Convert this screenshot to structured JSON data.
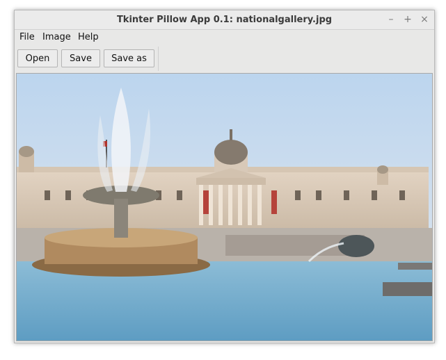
{
  "window": {
    "title": "Tkinter Pillow App 0.1: nationalgallery.jpg",
    "controls": {
      "minimize": "–",
      "maximize": "+",
      "close": "×"
    }
  },
  "menubar": {
    "items": [
      {
        "label": "File"
      },
      {
        "label": "Image"
      },
      {
        "label": "Help"
      }
    ]
  },
  "toolbar": {
    "open_label": "Open",
    "save_label": "Save",
    "save_as_label": "Save as"
  },
  "canvas": {
    "image_subject": "National Gallery with Trafalgar Square fountain"
  },
  "colors": {
    "window_bg": "#e8e8e7",
    "sky": "#c9dcef",
    "building": "#d9c7b4",
    "water": "#6fa9c7"
  }
}
